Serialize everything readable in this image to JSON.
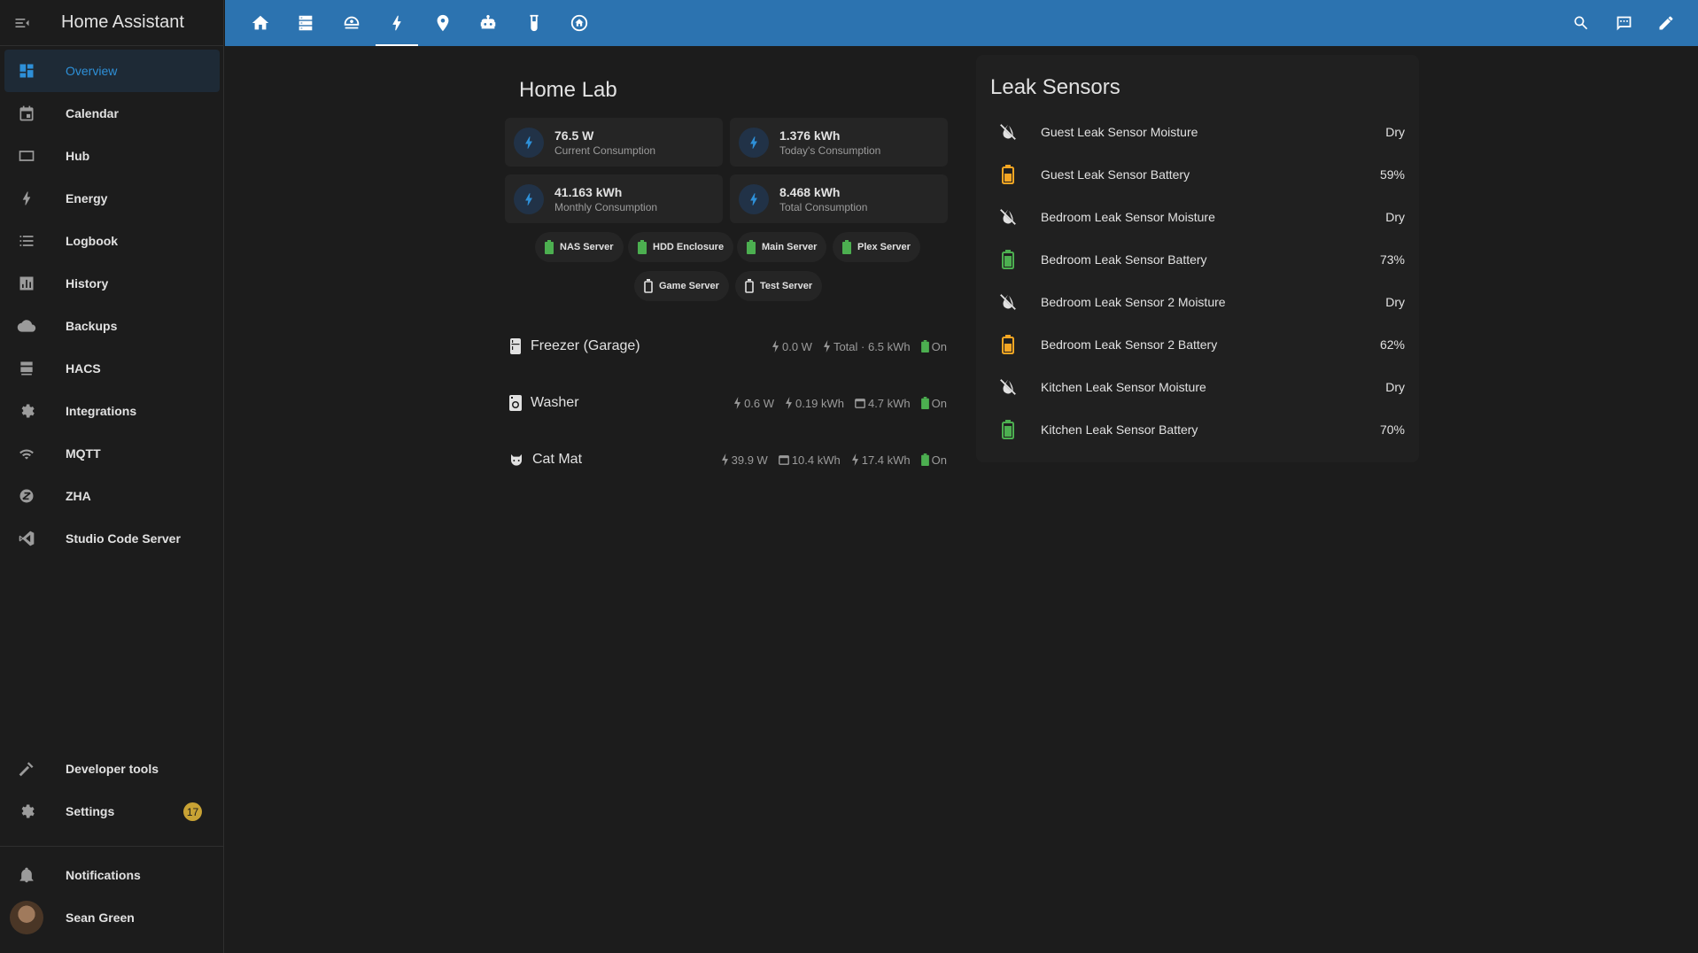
{
  "app": {
    "title": "Home Assistant"
  },
  "colors": {
    "topbar": "#2c73b0",
    "accent": "#2e90d8",
    "battery_ok": "#4caf50",
    "battery_warn": "#f5a623",
    "badge": "#c8a234",
    "background": "#1c1c1c",
    "card": "#202020"
  },
  "sidebar": {
    "items": [
      {
        "label": "Overview",
        "icon": "dashboard-icon",
        "active": true
      },
      {
        "label": "Calendar",
        "icon": "calendar-icon"
      },
      {
        "label": "Hub",
        "icon": "hub-icon"
      },
      {
        "label": "Energy",
        "icon": "lightning-bolt-icon"
      },
      {
        "label": "Logbook",
        "icon": "list-icon"
      },
      {
        "label": "History",
        "icon": "chart-bar-icon"
      },
      {
        "label": "Backups",
        "icon": "cloud-icon"
      },
      {
        "label": "HACS",
        "icon": "hacs-icon"
      },
      {
        "label": "Integrations",
        "icon": "gear-icon"
      },
      {
        "label": "MQTT",
        "icon": "wifi-icon"
      },
      {
        "label": "ZHA",
        "icon": "zigbee-icon"
      },
      {
        "label": "Studio Code Server",
        "icon": "code-icon"
      }
    ],
    "bottom": [
      {
        "label": "Developer tools",
        "icon": "hammer-icon"
      },
      {
        "label": "Settings",
        "icon": "cog-icon",
        "badge": "17"
      }
    ],
    "notifications": {
      "label": "Notifications",
      "icon": "bell-icon"
    },
    "user": {
      "name": "Sean Green"
    }
  },
  "topbar": {
    "tabs": [
      {
        "icon": "home-icon"
      },
      {
        "icon": "server-icon"
      },
      {
        "icon": "robot-vacuum-icon"
      },
      {
        "icon": "lightning-bolt-icon",
        "active": true
      },
      {
        "icon": "map-marker-icon"
      },
      {
        "icon": "robot-icon"
      },
      {
        "icon": "test-tube-icon"
      },
      {
        "icon": "home-circle-icon"
      }
    ],
    "actions": [
      {
        "icon": "search-icon"
      },
      {
        "icon": "assist-icon"
      },
      {
        "icon": "pencil-icon"
      }
    ]
  },
  "home_lab": {
    "title": "Home Lab",
    "tiles": [
      {
        "value": "76.5 W",
        "label": "Current Consumption"
      },
      {
        "value": "1.376 kWh",
        "label": "Today's Consumption"
      },
      {
        "value": "41.163 kWh",
        "label": "Monthly Consumption"
      },
      {
        "value": "8.468 kWh",
        "label": "Total Consumption"
      }
    ],
    "chips_row1": [
      {
        "label": "NAS Server",
        "icon": "battery-icon"
      },
      {
        "label": "HDD Enclosure",
        "icon": "battery-icon"
      },
      {
        "label": "Main Server",
        "icon": "battery-icon"
      },
      {
        "label": "Plex Server",
        "icon": "battery-icon"
      }
    ],
    "chips_row2": [
      {
        "label": "Game Server",
        "icon": "battery-outline-icon"
      },
      {
        "label": "Test Server",
        "icon": "battery-outline-icon"
      }
    ],
    "devices": [
      {
        "name": "Freezer (Garage)",
        "icon": "fridge-icon",
        "power": "0.0 W",
        "energy": "Total · 6.5 kWh",
        "state": "On"
      },
      {
        "name": "Washer",
        "icon": "washer-icon",
        "power": "0.6 W",
        "energy": "0.19 kWh",
        "month": "4.7 kWh",
        "state": "On"
      },
      {
        "name": "Cat Mat",
        "icon": "cat-icon",
        "power": "39.9 W",
        "month": "10.4 kWh",
        "energy": "17.4 kWh",
        "state": "On"
      }
    ]
  },
  "leak_sensors": {
    "title": "Leak Sensors",
    "rows": [
      {
        "name": "Guest Leak Sensor Moisture",
        "value": "Dry",
        "type": "moisture"
      },
      {
        "name": "Guest Leak Sensor Battery",
        "value": "59%",
        "type": "battery-warn"
      },
      {
        "name": "Bedroom Leak Sensor Moisture",
        "value": "Dry",
        "type": "moisture"
      },
      {
        "name": "Bedroom Leak Sensor Battery",
        "value": "73%",
        "type": "battery-ok"
      },
      {
        "name": "Bedroom Leak Sensor 2 Moisture",
        "value": "Dry",
        "type": "moisture"
      },
      {
        "name": "Bedroom Leak Sensor 2 Battery",
        "value": "62%",
        "type": "battery-warn"
      },
      {
        "name": "Kitchen Leak Sensor Moisture",
        "value": "Dry",
        "type": "moisture"
      },
      {
        "name": "Kitchen Leak Sensor Battery",
        "value": "70%",
        "type": "battery-ok"
      }
    ]
  }
}
